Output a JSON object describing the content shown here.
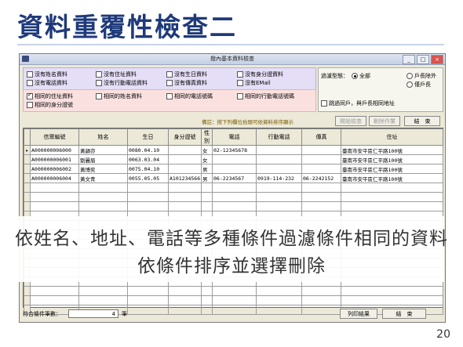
{
  "slide": {
    "title": "資料重覆性檢查二",
    "caption_line1": "依姓名、地址、電話等多種條件過濾條件相同的資料",
    "caption_line2": "依條件排序並選擇刪除",
    "page_number": "20"
  },
  "window": {
    "title": "撥內基本資料檢查"
  },
  "filters": {
    "duplicate": [
      {
        "label": "沒有姓名資料",
        "checked": false
      },
      {
        "label": "沒有住址資料",
        "checked": false
      },
      {
        "label": "沒有生日資料",
        "checked": false
      },
      {
        "label": "沒有身分證資料",
        "checked": false
      },
      {
        "label": "沒有電話資料",
        "checked": false
      },
      {
        "label": "沒有行動電話資料",
        "checked": false
      },
      {
        "label": "沒有傳真資料",
        "checked": false
      },
      {
        "label": "沒有EMail",
        "checked": false
      }
    ],
    "same": [
      {
        "label": "相同的住址資料",
        "checked": true
      },
      {
        "label": "相同的姓名資料",
        "checked": false
      },
      {
        "label": "相同的電話號碼",
        "checked": false
      },
      {
        "label": "相同的行動電話號碼",
        "checked": false
      },
      {
        "label": "相同的身分證號",
        "checked": false
      }
    ]
  },
  "options": {
    "filter_type_label": "過濾型態：",
    "radios": [
      {
        "label": "全部",
        "selected": true
      },
      {
        "label": "戶長除外",
        "selected": false
      },
      {
        "label": "僅戶長",
        "selected": false
      }
    ],
    "skip_same_household": "跳過同戶，與戶長相同地址"
  },
  "hint": "備註：按下列欄位抬頭可依資料排序顯示",
  "buttons": {
    "start_check": "開始檢查",
    "delete": "刪除作業",
    "end": "結　束",
    "print": "列印結果",
    "end_bottom": "結　束"
  },
  "table": {
    "columns": [
      "信眾編號",
      "姓名",
      "生日",
      "身分證號",
      "性別",
      "電話",
      "行動電話",
      "傳真",
      "住址"
    ],
    "rows": [
      [
        "A000000006000",
        "黃韻亦",
        "0080.04.10",
        "",
        "女",
        "02-12345678",
        "",
        "",
        "臺南市安平區仁平路100號"
      ],
      [
        "A000000006001",
        "劉麗眉",
        "0063.03.04",
        "",
        "女",
        "",
        "",
        "",
        "臺南市安平區仁平路100號"
      ],
      [
        "A000000006002",
        "黃博奕",
        "0075.04.10",
        "",
        "男",
        "",
        "",
        "",
        "臺南市安平區仁平路100號"
      ],
      [
        "A000000006004",
        "黃文青",
        "0055.05.05",
        "A101234566",
        "男",
        "06-2234567",
        "0919-114-232",
        "06-2242152",
        "臺南市安平區仁平路100號"
      ]
    ],
    "empty_rows": 14
  },
  "status": {
    "count_label": "符合條件筆數：",
    "count_value": "4",
    "count_unit": "筆"
  }
}
